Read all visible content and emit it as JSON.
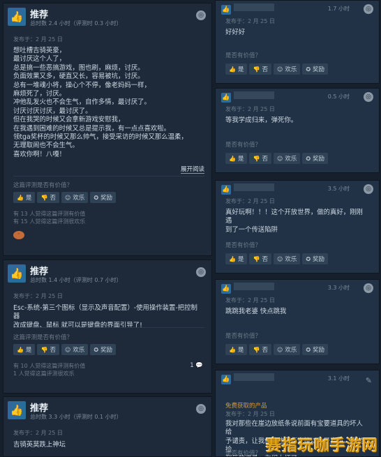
{
  "left": {
    "card1": {
      "rec": "推荐",
      "hours": "总时数 2.4 小时（评测时 0.3 小时）",
      "posted": "发布于：2 月 25 日",
      "body": "想吐槽吉骑英豪，\n最讨厌这个人了，\n总是搞一些恶搞游戏，图也刷，麻烦，讨厌。\n负面效果又多，硬直又长，容易被坑，讨厌。\n总有一堆魂小将，操心个不停，像老妈妈一样，\n麻烦死了，讨厌。\n冲他乱发火也不会生气，自作多情，最讨厌了。\n讨厌讨厌讨厌，最讨厌了。\n但在我哭的时候又会拿新游戏安慰我，\n在我遇到困难的时候又总是提示我，有一点点喜欢啦。\n领tga奖杯的时候又那么帅气，接受采访的时候又那么温柔，\n无理取闹也不会生气。\n喜欢你啊！八嘎！",
      "expand": "展开阅读",
      "helpful_q": "这篇评测是否有价值？",
      "buttons": [
        "是",
        "否",
        "欢乐",
        "奖励"
      ],
      "stats": [
        "有 13 人觉得这篇评测有价值",
        "有 15 人觉得这篇评测很欢乐"
      ]
    },
    "card2": {
      "rec": "推荐",
      "hours": "总时数 1.4 小时（评测时 0.7 小时）",
      "posted": "发布于：2 月 25 日",
      "body": "Esc-系统-第三个图标（显示及声音配置）-使用操作装置-把控制器\n改成键盘、鼠标 就可以是键盘的界面引导了!",
      "helpful_q": "这篇评测是否有价值？",
      "buttons": [
        "是",
        "否",
        "欢乐",
        "奖励"
      ],
      "stats": [
        "有 10 人觉得这篇评测有价值",
        "1 人觉得这篇评测很欢乐"
      ],
      "comments": "1"
    },
    "card3": {
      "rec": "推荐",
      "hours": "总时数 3.3 小时（评测时 0.1 小时）",
      "posted": "发布于：2 月 25 日",
      "body": "吉骑英莫跌上神坛"
    }
  },
  "right": {
    "r1": {
      "hours": "1.7 小时",
      "posted": "发布于：2 月 25 日",
      "body": "好好好",
      "helpful_q": "是否有价值？",
      "buttons": [
        "是",
        "否",
        "欢乐",
        "奖励"
      ]
    },
    "r2": {
      "hours": "0.5 小时",
      "posted": "发布于：2 月 25 日",
      "body": "等我学成归来，弹死你。",
      "helpful_q": "是否有价值？",
      "buttons": [
        "是",
        "否",
        "欢乐",
        "奖励"
      ]
    },
    "r3": {
      "hours": "3.5 小时",
      "posted": "发布于：2 月 25 日",
      "body": "真好玩啊！！！这个开放世界，做的真好，刚刚遇\n到了一个传送陷阱",
      "helpful_q": "是否有价值？",
      "buttons": [
        "是",
        "否",
        "欢乐",
        "奖励"
      ]
    },
    "r4": {
      "hours": "3.3 小时",
      "posted": "发布于：2 月 25 日",
      "body": "跳跳我老婆 快点跳我",
      "helpful_q": "是否有价值？",
      "buttons": [
        "是",
        "否",
        "欢乐",
        "奖励"
      ]
    },
    "r5": {
      "hours": "3.1 小时",
      "free": "免费获取的产品",
      "posted": "发布于：2 月 25 日",
      "body": "我对那些在崖边放纸条说前面有宝要道具的坏人给\n予谴责，让我们这些萌新直接以为是真的，跳崖捡\n到死的道具，你们太坏了",
      "helpful_q": "是否有价值？"
    }
  },
  "watermark": "赛指玩咖手游网"
}
